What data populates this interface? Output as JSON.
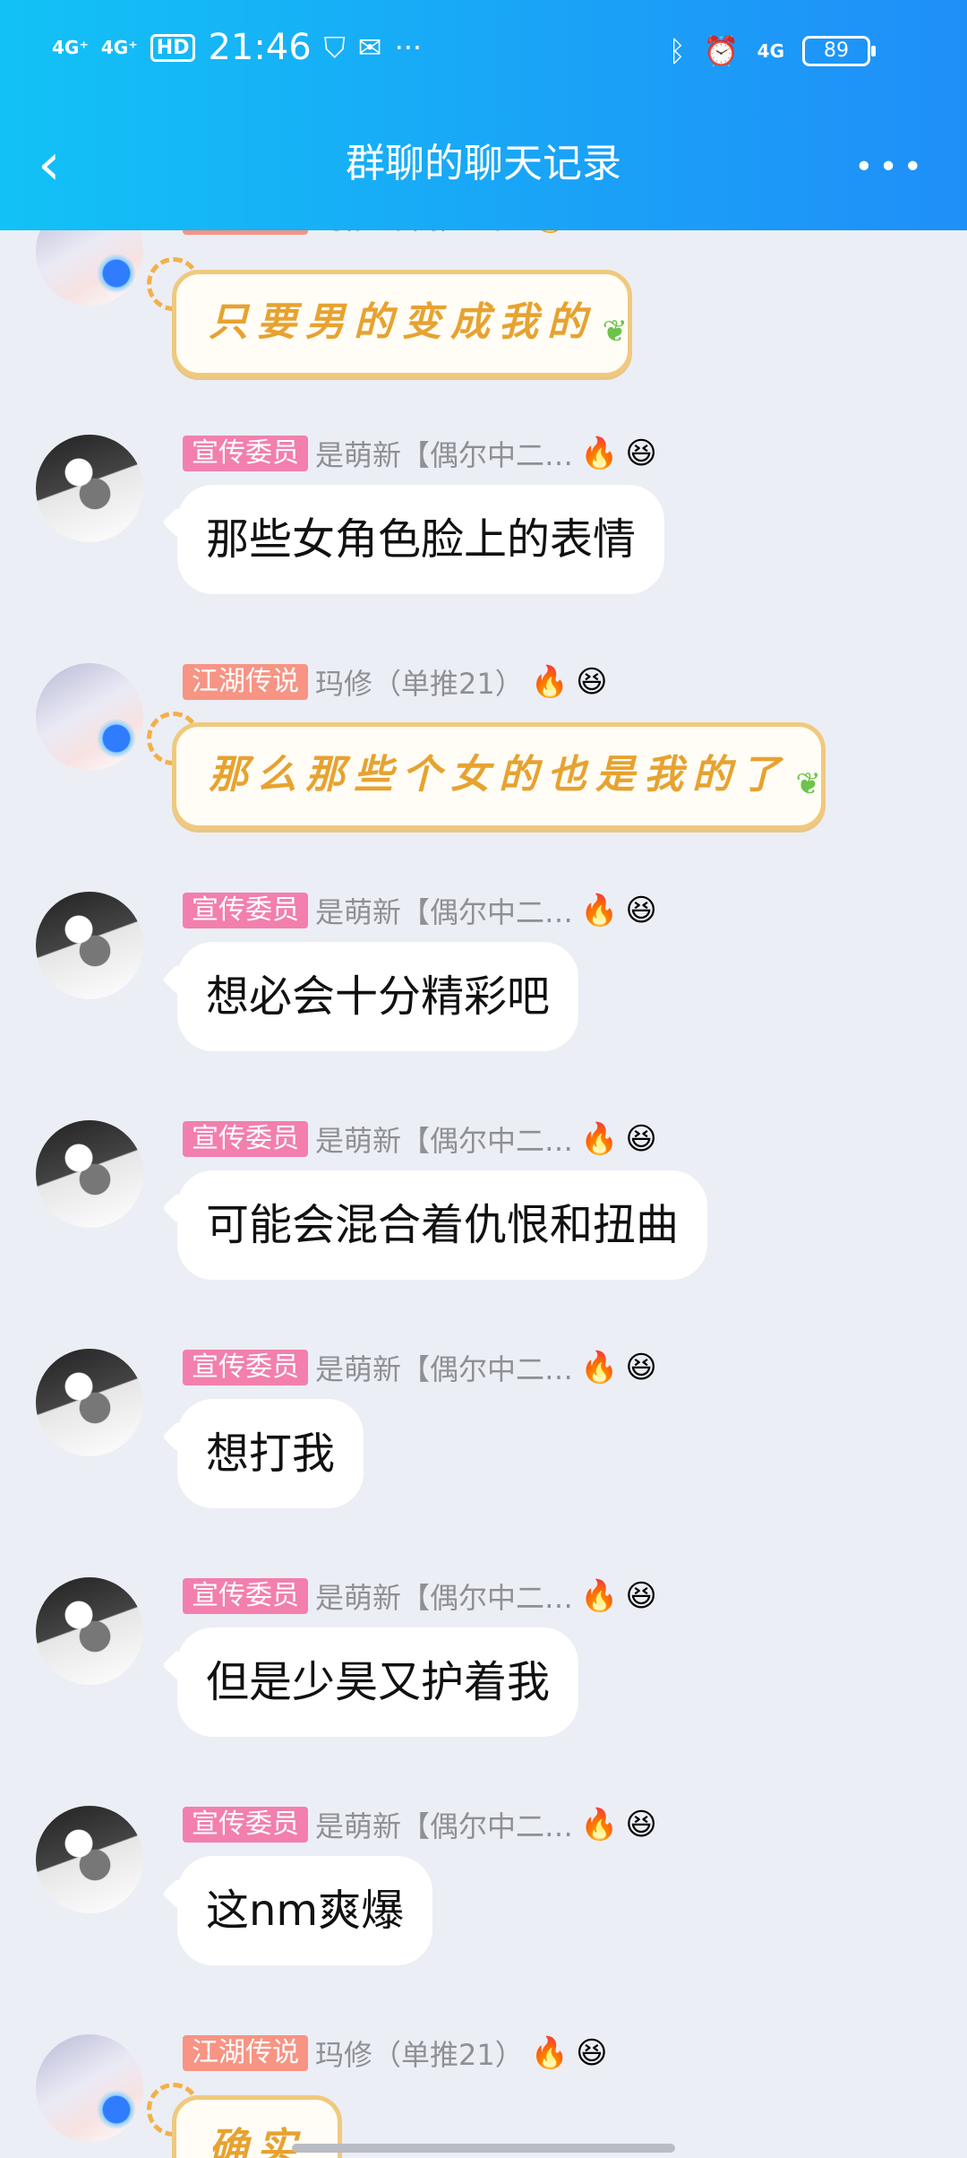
{
  "status": {
    "signal1": "4G⁺",
    "signal2": "4G⁺",
    "hd": "HD",
    "time": "21:46",
    "more_dots": "···",
    "net": "4G",
    "battery": "89"
  },
  "nav": {
    "title": "群聊的聊天记录",
    "back_glyph": "‹",
    "more_glyph": "•••"
  },
  "labels": {
    "pink": "宣传委员",
    "salmon": "江湖传说"
  },
  "names": {
    "a": "是萌新【偶尔中二…",
    "b": "玛修（单推21）"
  },
  "emoji": {
    "fire": "🔥",
    "face": "😆"
  },
  "leaf_glyph": "❦",
  "messages": [
    {
      "kind": "fancy",
      "text": "只要男的变成我的"
    },
    {
      "kind": "plain",
      "text": "那些女角色脸上的表情"
    },
    {
      "kind": "fancy",
      "text": "那么那些个女的也是我的了"
    },
    {
      "kind": "plain",
      "text": "想必会十分精彩吧"
    },
    {
      "kind": "plain",
      "text": "可能会混合着仇恨和扭曲"
    },
    {
      "kind": "plain",
      "text": "想打我"
    },
    {
      "kind": "plain",
      "text": "但是少昊又护着我"
    },
    {
      "kind": "plain",
      "text": "这nm爽爆"
    },
    {
      "kind": "fancy",
      "text": "确实"
    }
  ]
}
